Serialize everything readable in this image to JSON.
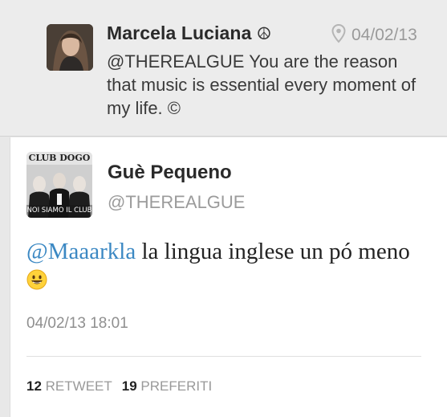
{
  "context_tweet": {
    "author_name": "Marcela Luciana",
    "peace_symbol": "☮",
    "date": "04/02/13",
    "text": "@THEREALGUE You are the reason that music is essential every moment of my life. ©",
    "location_icon": "location-pin-icon",
    "avatar_icon": "profile-photo"
  },
  "main_tweet": {
    "author_name": "Guè Pequeno",
    "handle": "@THEREALGUE",
    "avatar_caption_top": "CLUB DOGO",
    "avatar_caption_bottom": "NOI SIAMO IL CLUB",
    "mention": "@Maaarkla",
    "text": " la lingua inglese un pó meno",
    "emoji_icon": "smiling-face-emoji",
    "timestamp": "04/02/13 18:01",
    "retweet_count": "12",
    "retweet_label": "RETWEET",
    "favorite_count": "19",
    "favorite_label": "PREFERITI"
  },
  "colors": {
    "mention": "#3b88c3",
    "muted_text": "#9b9b9b",
    "background": "#ececec"
  }
}
